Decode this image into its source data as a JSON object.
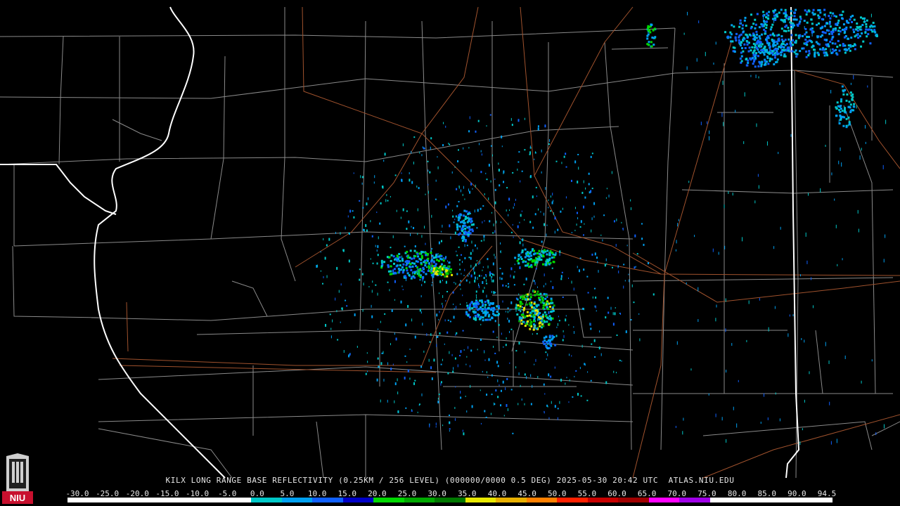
{
  "title": "KILX LONG RANGE BASE REFLECTIVITY (0.25KM / 256 LEVEL) (000000/0000 0.5 DEG) 2025-05-30 20:42 UTC  ATLAS.NIU.EDU",
  "logo_text": "NIU",
  "scale": {
    "ticks": [
      "-30.0",
      "-25.0",
      "-20.0",
      "-15.0",
      "-10.0",
      "-5.0",
      "0.0",
      "5.0",
      "10.0",
      "15.0",
      "20.0",
      "25.0",
      "30.0",
      "35.0",
      "40.0",
      "45.0",
      "50.0",
      "55.0",
      "60.0",
      "65.0",
      "70.0",
      "75.0",
      "80.0",
      "85.0",
      "90.0",
      "94.5"
    ],
    "colors": [
      "#ffffff",
      "#ffffff",
      "#ffffff",
      "#ffffff",
      "#ffffff",
      "#ffffff",
      "#00c8c8",
      "#00a0f0",
      "#1060ff",
      "#0000c8",
      "#00d800",
      "#00a800",
      "#007800",
      "#e8e800",
      "#e8b000",
      "#ff8000",
      "#ff2000",
      "#c80000",
      "#a00000",
      "#ff00ff",
      "#a000e8",
      "#ffffff",
      "#ffffff",
      "#ffffff",
      "#ffffff"
    ]
  },
  "colors": {
    "background": "#000000",
    "county_lines": "#8a8a8a",
    "state_lines": "#ffffff",
    "highways": "#a0522d"
  }
}
